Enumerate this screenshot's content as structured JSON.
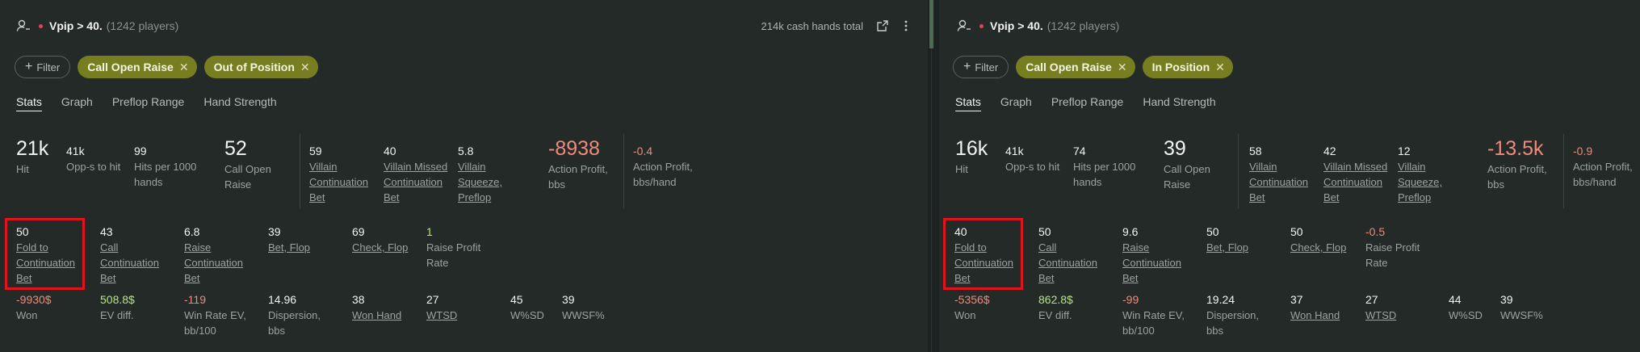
{
  "left": {
    "header": {
      "title": "Vpip > 40.",
      "subtitle": "(1242 players)",
      "hands_total": "214k cash hands total"
    },
    "filter_label": "Filter",
    "chips": [
      "Call Open Raise",
      "Out of Position"
    ],
    "tabs": [
      "Stats",
      "Graph",
      "Preflop Range",
      "Hand Strength"
    ],
    "row1": [
      {
        "value": "21k",
        "label": "Hit"
      },
      {
        "value": "41k",
        "label": "Opp-s to hit"
      },
      {
        "value": "99",
        "label": "Hits per 1000 hands"
      },
      {
        "value": "52",
        "label": "Call Open Raise"
      },
      {
        "value": "59",
        "label": "Villain Continuation Bet"
      },
      {
        "value": "40",
        "label": "Villain Missed Continuation Bet"
      },
      {
        "value": "5.8",
        "label": "Villain Squeeze, Preflop"
      },
      {
        "value": "-8938",
        "label": "Action Profit, bbs"
      },
      {
        "value": "-0.4",
        "label": "Action Profit, bbs/hand"
      }
    ],
    "row2": [
      {
        "value": "50",
        "label": "Fold to Continuation Bet"
      },
      {
        "value": "43",
        "label": "Call Continuation Bet"
      },
      {
        "value": "6.8",
        "label": "Raise Continuation Bet"
      },
      {
        "value": "39",
        "label": "Bet, Flop"
      },
      {
        "value": "69",
        "label": "Check, Flop"
      },
      {
        "value": "1",
        "label": "Raise Profit Rate"
      }
    ],
    "row3": [
      {
        "value": "-9930$",
        "label": "Won"
      },
      {
        "value": "508.8$",
        "label": "EV diff."
      },
      {
        "value": "-119",
        "label": "Win Rate EV, bb/100"
      },
      {
        "value": "14.96",
        "label": "Dispersion, bbs"
      },
      {
        "value": "38",
        "label": "Won Hand"
      },
      {
        "value": "27",
        "label": "WTSD"
      },
      {
        "value": "45",
        "label": "W%SD"
      },
      {
        "value": "39",
        "label": "WWSF%"
      }
    ]
  },
  "right": {
    "header": {
      "title": "Vpip > 40.",
      "subtitle": "(1242 players)"
    },
    "filter_label": "Filter",
    "chips": [
      "Call Open Raise",
      "In Position"
    ],
    "tabs": [
      "Stats",
      "Graph",
      "Preflop Range",
      "Hand Strength"
    ],
    "row1": [
      {
        "value": "16k",
        "label": "Hit"
      },
      {
        "value": "41k",
        "label": "Opp-s to hit"
      },
      {
        "value": "74",
        "label": "Hits per 1000 hands"
      },
      {
        "value": "39",
        "label": "Call Open Raise"
      },
      {
        "value": "58",
        "label": "Villain Continuation Bet"
      },
      {
        "value": "42",
        "label": "Villain Missed Continuation Bet"
      },
      {
        "value": "12",
        "label": "Villain Squeeze, Preflop"
      },
      {
        "value": "-13.5k",
        "label": "Action Profit, bbs"
      },
      {
        "value": "-0.9",
        "label": "Action Profit, bbs/hand"
      }
    ],
    "row2": [
      {
        "value": "40",
        "label": "Fold to Continuation Bet"
      },
      {
        "value": "50",
        "label": "Call Continuation Bet"
      },
      {
        "value": "9.6",
        "label": "Raise Continuation Bet"
      },
      {
        "value": "50",
        "label": "Bet, Flop"
      },
      {
        "value": "50",
        "label": "Check, Flop"
      },
      {
        "value": "-0.5",
        "label": "Raise Profit Rate"
      }
    ],
    "row3": [
      {
        "value": "-5356$",
        "label": "Won"
      },
      {
        "value": "862.8$",
        "label": "EV diff."
      },
      {
        "value": "-99",
        "label": "Win Rate EV, bb/100"
      },
      {
        "value": "19.24",
        "label": "Dispersion, bbs"
      },
      {
        "value": "37",
        "label": "Won Hand"
      },
      {
        "value": "27",
        "label": "WTSD"
      },
      {
        "value": "44",
        "label": "W%SD"
      },
      {
        "value": "39",
        "label": "WWSF%"
      }
    ]
  },
  "colors": {
    "accent_chip": "#767e20",
    "negative": "#ef8a7c",
    "positive": "#b7e585",
    "highlight": "#e0141c",
    "dot": "#e0435a"
  },
  "icons": {
    "user": "user-icon",
    "external": "external-link-icon",
    "menu": "kebab-menu-icon",
    "close": "close-icon",
    "add": "plus-icon"
  }
}
